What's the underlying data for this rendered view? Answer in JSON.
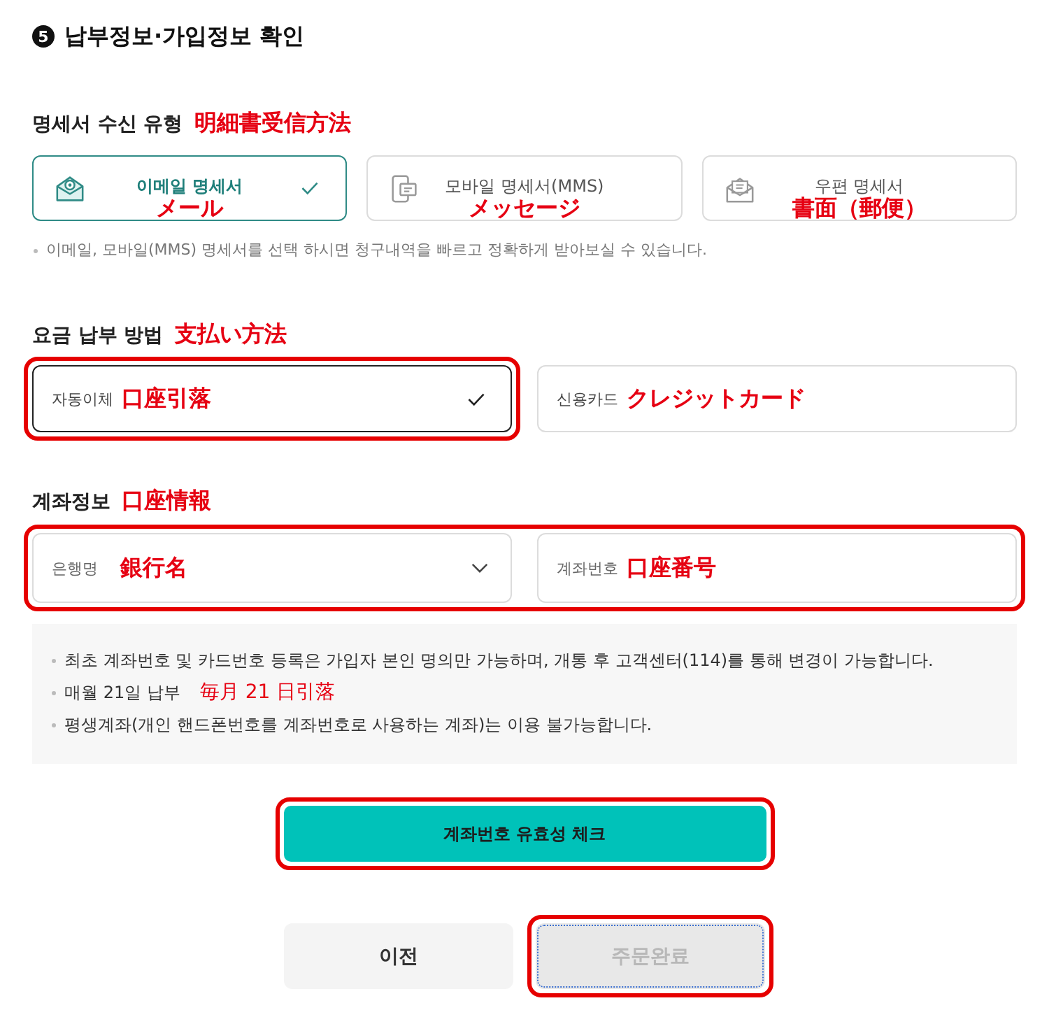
{
  "heading": {
    "step": "5",
    "title": "납부정보·가입정보 확인"
  },
  "statement_type": {
    "label": "명세서 수신 유형",
    "annotation": "明細書受信方法",
    "options": [
      {
        "kind": "email",
        "label": "이메일 명세서",
        "annotation": "メール",
        "selected": true
      },
      {
        "kind": "mobile",
        "label": "모바일 명세서(MMS)",
        "annotation": "メッセージ",
        "selected": false
      },
      {
        "kind": "post",
        "label": "우편 명세서",
        "annotation": "書面（郵便）",
        "selected": false
      }
    ],
    "note": "이메일, 모바일(MMS) 명세서를 선택 하시면 청구내역을 빠르고 정확하게 받아보실 수 있습니다."
  },
  "payment_method": {
    "label": "요금 납부 방법",
    "annotation": "支払い方法",
    "options": [
      {
        "label": "자동이체",
        "annotation": "口座引落",
        "selected": true,
        "highlighted": true
      },
      {
        "label": "신용카드",
        "annotation": "クレジットカード",
        "selected": false,
        "highlighted": false
      }
    ]
  },
  "account_info": {
    "label": "계좌정보",
    "annotation": "口座情報",
    "highlighted": true,
    "fields": [
      {
        "kind": "select",
        "label": "은행명",
        "annotation": "銀行名"
      },
      {
        "kind": "input",
        "label": "계좌번호",
        "annotation": "口座番号"
      }
    ]
  },
  "notices": [
    {
      "text": "최초 계좌번호 및 카드번호 등록은 가입자 본인 명의만 가능하며, 개통 후 고객센터(114)를 통해 변경이 가능합니다."
    },
    {
      "text": "매월 21일 납부",
      "annotation": "毎月 21 日引落"
    },
    {
      "text": "평생계좌(개인 핸드폰번호를 계좌번호로 사용하는 계좌)는 이용 불가능합니다."
    }
  ],
  "check_button": {
    "label": "계좌번호 유효성 체크",
    "highlighted": true
  },
  "buttons": [
    {
      "label": "이전",
      "disabled": false,
      "focused": false,
      "highlighted": false
    },
    {
      "label": "주문완료",
      "disabled": true,
      "focused": true,
      "highlighted": true
    }
  ]
}
